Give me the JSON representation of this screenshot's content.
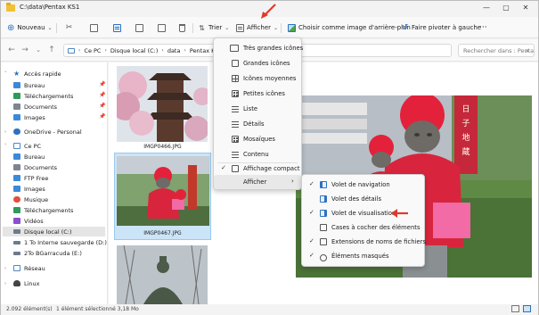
{
  "window": {
    "title": "C:\\data\\Pentax KS1",
    "minimize": "—",
    "maximize": "▢",
    "close": "✕"
  },
  "toolbar": {
    "new_label": "Nouveau",
    "sort_label": "Trier",
    "view_label": "Afficher",
    "set_background_label": "Choisir comme image d'arrière-plan",
    "rotate_label": "Faire pivoter à gauche",
    "more_label": "···"
  },
  "address": {
    "crumbs": [
      "Ce PC",
      "Disque local (C:)",
      "data",
      "Pentax KS1"
    ],
    "search_placeholder": "Rechercher dans : Pentax KS1"
  },
  "sidebar": {
    "items": [
      {
        "label": "Accès rapide",
        "color": "#2d72c2"
      },
      {
        "label": "Bureau",
        "color": "#3b8ad9",
        "pinned": true
      },
      {
        "label": "Téléchargements",
        "color": "#2d9c5a",
        "pinned": true
      },
      {
        "label": "Documents",
        "color": "#7d8590",
        "pinned": true
      },
      {
        "label": "Images",
        "color": "#3b8ad9",
        "pinned": true
      },
      {
        "label": "OneDrive - Personal",
        "color": "#2d72c2"
      },
      {
        "label": "Ce PC",
        "color": "#4d87c7"
      },
      {
        "label": "Bureau",
        "color": "#3b8ad9"
      },
      {
        "label": "Documents",
        "color": "#7d8590"
      },
      {
        "label": "FTP Free",
        "color": "#3b8ad9"
      },
      {
        "label": "Images",
        "color": "#3b8ad9"
      },
      {
        "label": "Musique",
        "color": "#e0503c"
      },
      {
        "label": "Téléchargements",
        "color": "#2d9c5a"
      },
      {
        "label": "Vidéos",
        "color": "#8a4fd1"
      },
      {
        "label": "Disque local (C:)",
        "color": "#6b7b8c"
      },
      {
        "label": "1 To Interne sauvegarde (D:)",
        "color": "#6b7b8c"
      },
      {
        "label": "2To BGarracuda (E:)",
        "color": "#6b7b8c"
      },
      {
        "label": "Réseau",
        "color": "#4d87c7"
      },
      {
        "label": "Linux",
        "color": "#444444"
      }
    ],
    "pin_glyph": "📌"
  },
  "files": [
    {
      "name": "IMGP0466.JPG"
    },
    {
      "name": "IMGP0467.JPG"
    }
  ],
  "view_menu": {
    "items": [
      "Très grandes icônes",
      "Grandes icônes",
      "Icônes moyennes",
      "Petites icônes",
      "Liste",
      "Détails",
      "Mosaïques",
      "Contenu",
      "Affichage compact",
      "Afficher"
    ],
    "checked_index": 8,
    "submenu_chevron": "›"
  },
  "show_submenu": {
    "items": [
      {
        "label": "Volet de navigation",
        "checked": true
      },
      {
        "label": "Volet des détails",
        "checked": false
      },
      {
        "label": "Volet de visualisation",
        "checked": true
      },
      {
        "label": "Cases à cocher des éléments",
        "checked": false
      },
      {
        "label": "Extensions de noms de fichiers",
        "checked": true
      },
      {
        "label": "Éléments masqués",
        "checked": true
      }
    ]
  },
  "status": {
    "count": "2.092 élément(s)",
    "selection": "1 élément sélectionné  3,18 Mo"
  },
  "colors": {
    "accent": "#2d72c2",
    "annotation_arrow": "#e0392b",
    "selection": "#cce4f7"
  }
}
